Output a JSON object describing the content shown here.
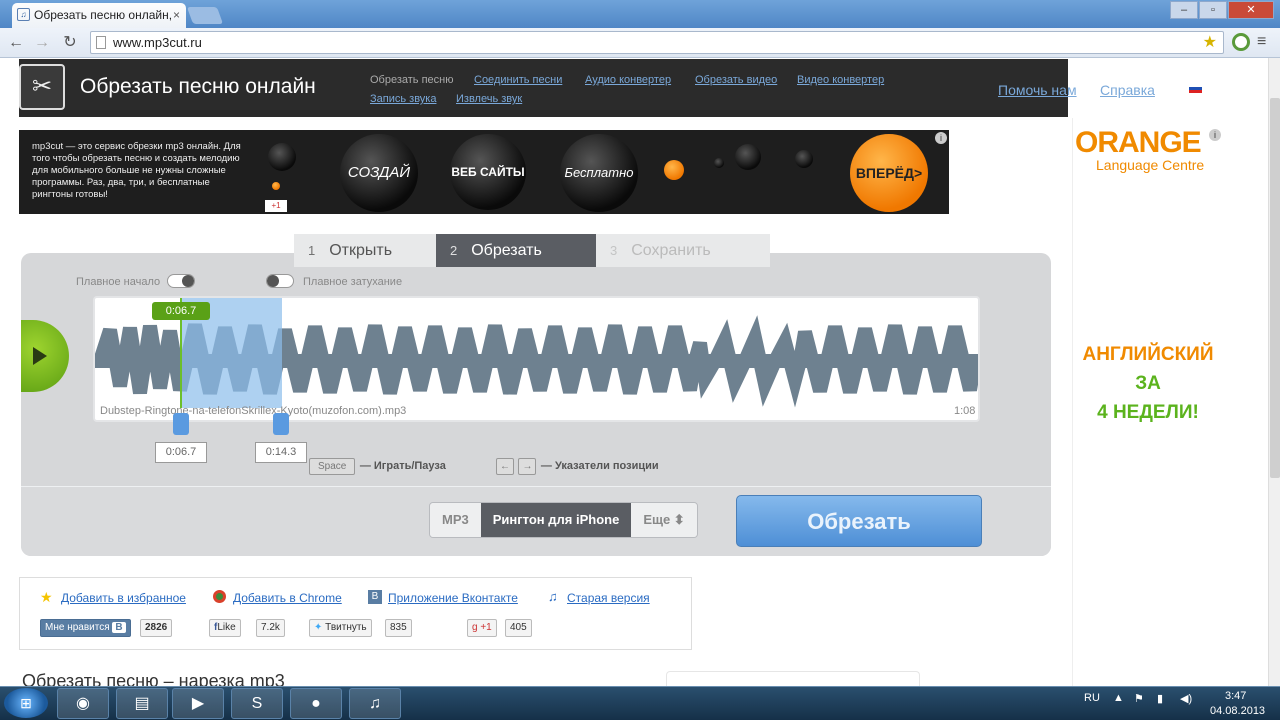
{
  "browser": {
    "tab_title": "Обрезать песню онлайн,",
    "tab_close": "×",
    "url": "www.mp3cut.ru",
    "win_min": "–",
    "win_max": "▫",
    "win_close": "✕"
  },
  "header": {
    "title": "Обрезать песню онлайн",
    "nav": [
      "Обрезать песню",
      "Соединить песни",
      "Аудио конвертер",
      "Обрезать видео",
      "Видео конвертер",
      "Запись звука",
      "Извлечь звук"
    ],
    "help_us": "Помочь нам",
    "help": "Справка",
    "language": "Русский"
  },
  "banner": {
    "text": "mp3cut — это сервис обрезки mp3 онлайн. Для того чтобы обрезать песню и создать мелодию для мобильного больше не нужны сложные программы. Раз, два, три, и бесплатные рингтоны готовы!",
    "balls": [
      "СОЗДАЙ",
      "ВЕБ САЙТЫ",
      "Бесплатно"
    ],
    "cta": "ВПЕРЁД>",
    "gplus": "+1",
    "info": "i"
  },
  "side_ad": {
    "brand": "ORANGE",
    "subtitle": "Language Centre",
    "line1": "АНГЛИЙСКИЙ",
    "line2": "ЗА",
    "line3": "4 НЕДЕЛИ!",
    "colors": {
      "orange": "#f08a00",
      "green": "#5bb31d"
    }
  },
  "editor": {
    "steps": [
      {
        "num": "1",
        "label": "Открыть"
      },
      {
        "num": "2",
        "label": "Обрезать"
      },
      {
        "num": "3",
        "label": "Сохранить"
      }
    ],
    "fade_in": "Плавное начало",
    "fade_out": "Плавное затухание",
    "marker_time": "0:06.7",
    "file_name": "Dubstep-Ringtone-na-telefonSkrillex-Kyoto(muzofon.com).mp3",
    "duration": "1:08",
    "start_time": "0:06.7",
    "end_time": "0:14.3",
    "space_key": "Space",
    "play_pause_hint": "— Играть/Пауза",
    "arrow_left": "←",
    "arrow_right": "→",
    "position_hint": "— Указатели позиции",
    "formats": [
      "MP3",
      "Рингтон для iPhone",
      "Еще ⬍"
    ],
    "selected_format": "Рингтон для iPhone",
    "cut_button": "Обрезать"
  },
  "share": {
    "links": [
      "Добавить в избранное",
      "Добавить в Chrome",
      "Приложение Вконтакте",
      "Старая версия"
    ],
    "vk_like": "Мне нравится",
    "vk_count": "2826",
    "fb_like": "Like",
    "fb_count": "7.2k",
    "tweet": "Твитнуть",
    "tweet_count": "835",
    "gplus": "+1",
    "gplus_count": "405"
  },
  "page_heading": "Обрезать песню – нарезка mp3",
  "taskbar": {
    "lang": "RU",
    "time": "3:47",
    "date": "04.08.2013"
  }
}
